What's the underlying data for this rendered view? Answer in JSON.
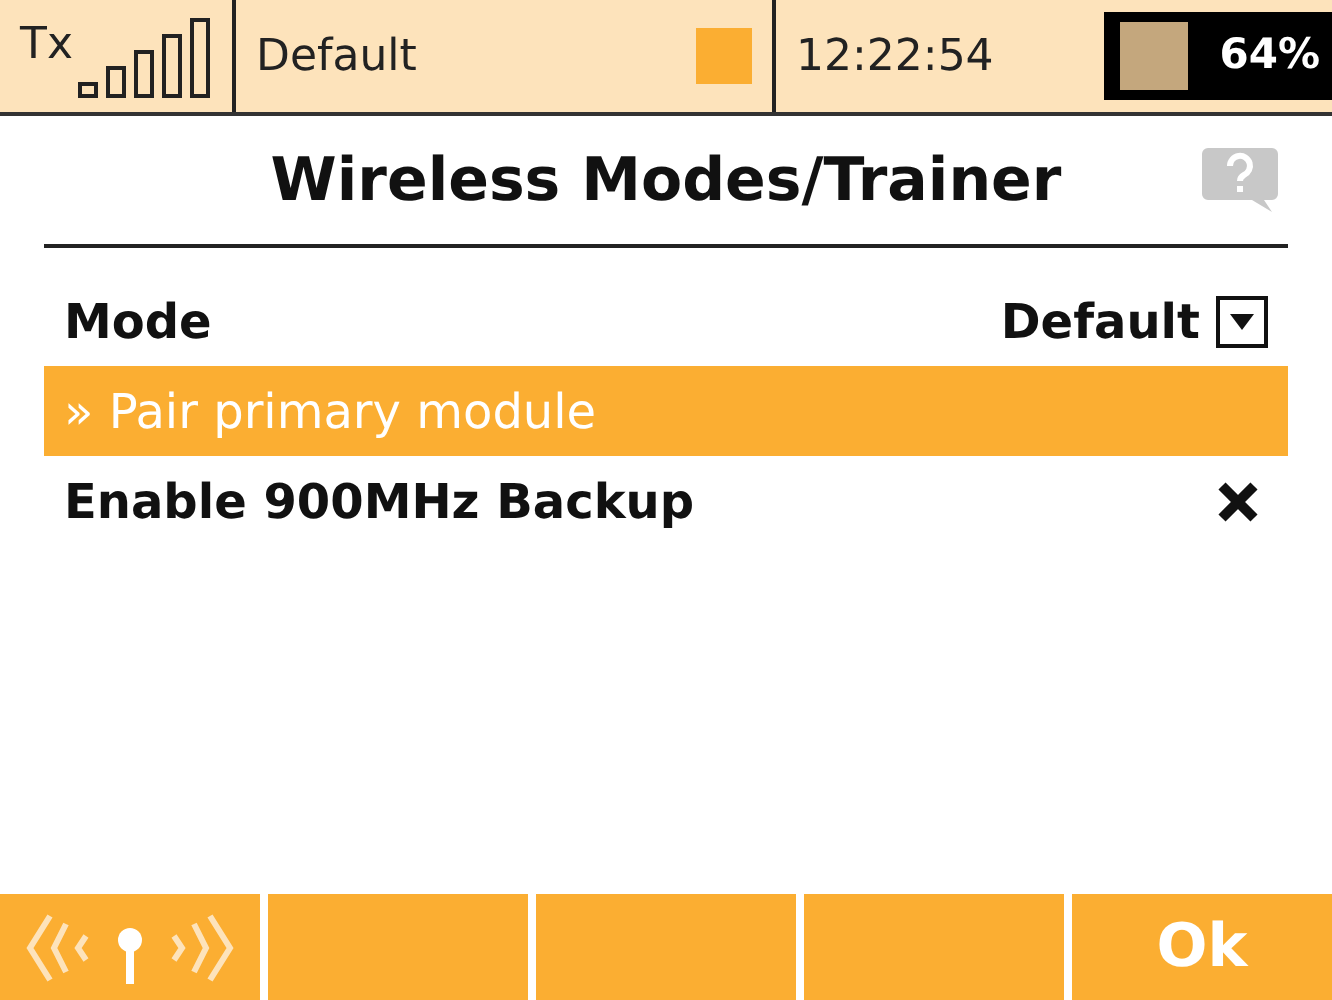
{
  "status_bar": {
    "tx_label": "Tx",
    "model": "Default",
    "time": "12:22:54",
    "battery": "64%"
  },
  "title": "Wireless Modes/Trainer",
  "rows": [
    {
      "kind": "dropdown",
      "label": "Mode",
      "value": "Default",
      "selected": false
    },
    {
      "kind": "action",
      "label": "» Pair primary module",
      "selected": true
    },
    {
      "kind": "checkbox",
      "label": "Enable 900MHz Backup",
      "checked": false,
      "selected": false
    }
  ],
  "footer": [
    {
      "kind": "icon"
    },
    {
      "kind": "empty"
    },
    {
      "kind": "empty"
    },
    {
      "kind": "empty"
    },
    {
      "kind": "text",
      "label": "Ok"
    }
  ]
}
